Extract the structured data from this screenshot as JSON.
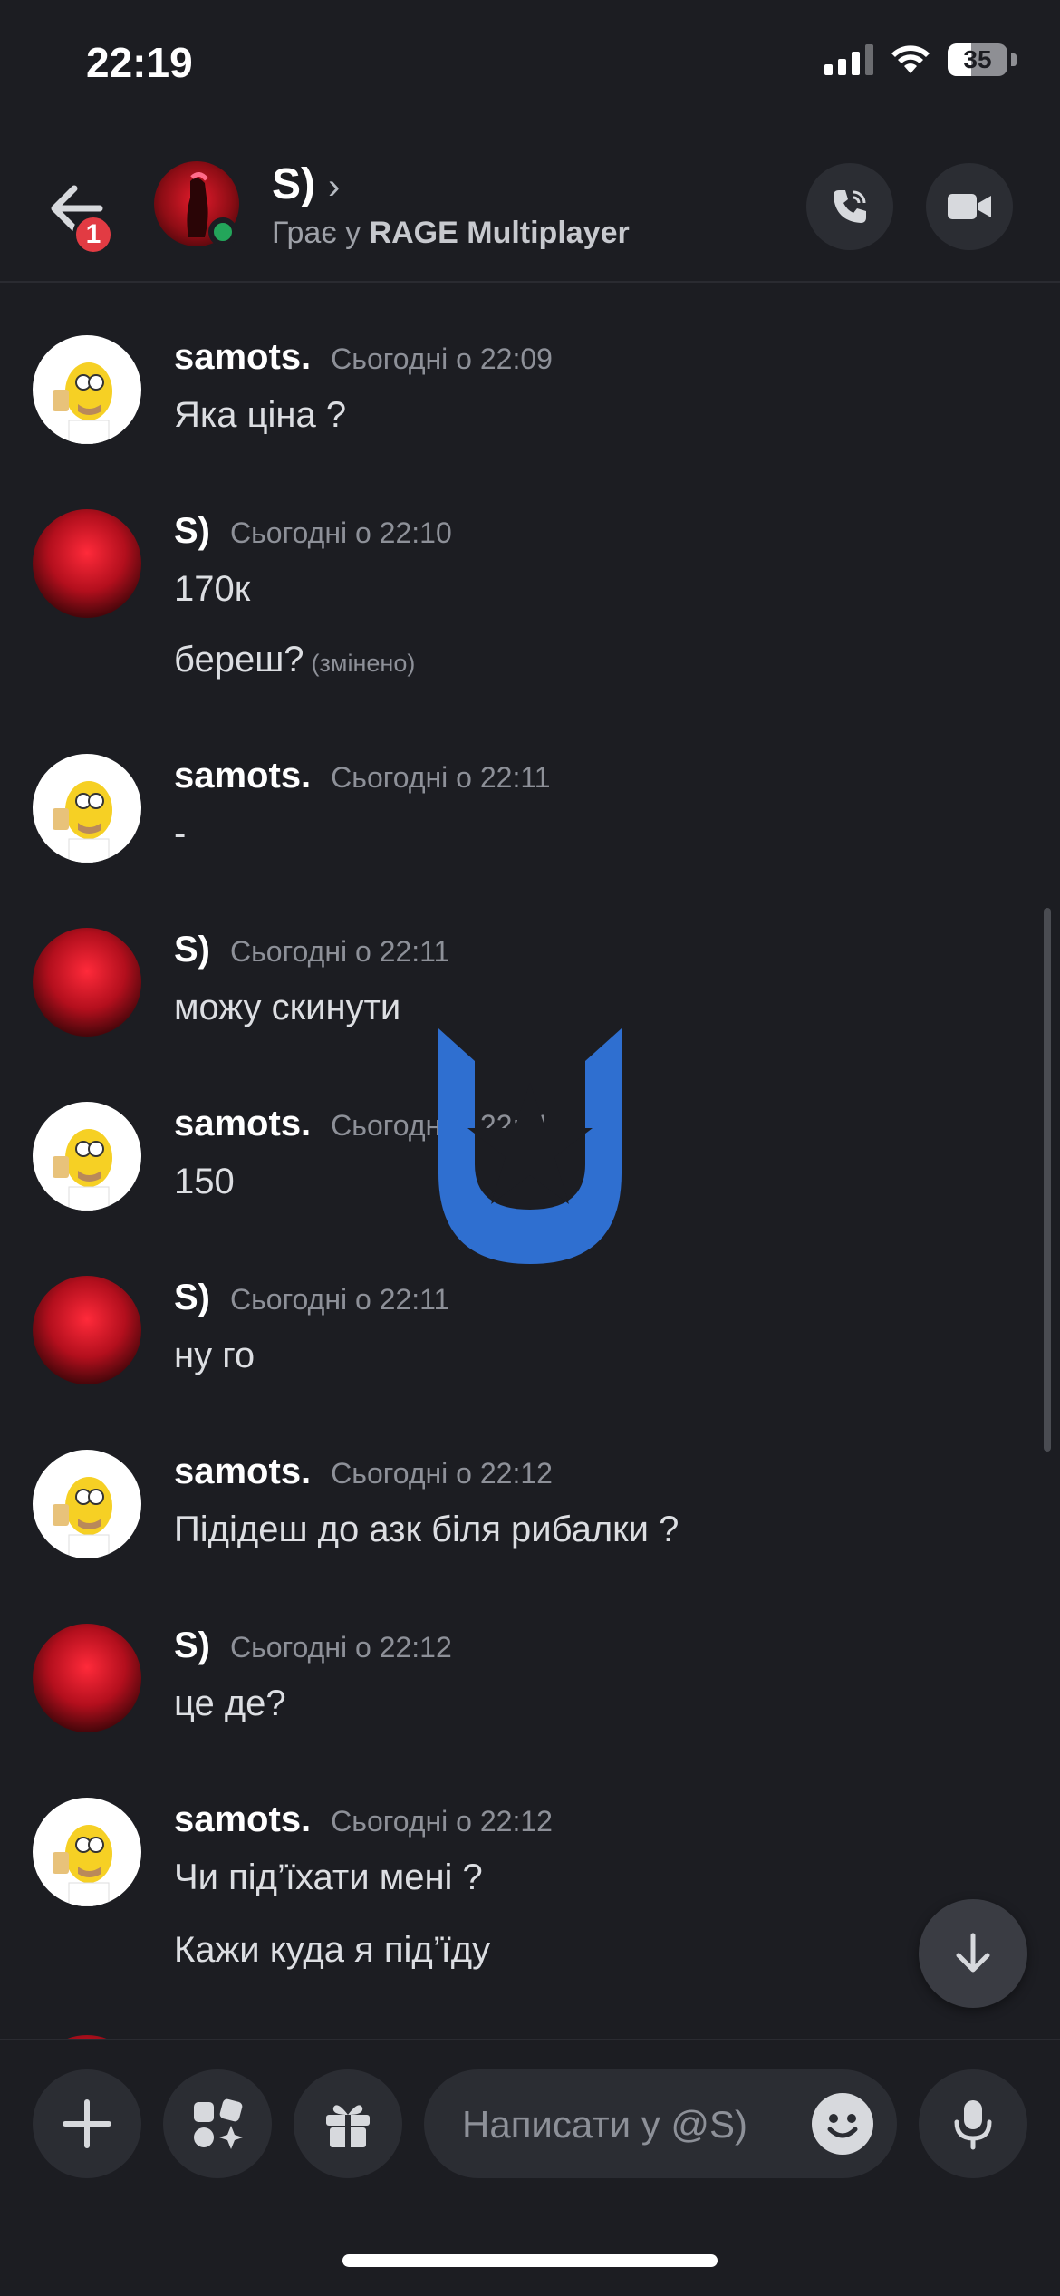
{
  "status_bar": {
    "time": "22:19",
    "battery": "35"
  },
  "header": {
    "name": "S)",
    "status_prefix": "Грає у ",
    "status_game": "RAGE Multiplayer",
    "unread_badge": "1",
    "icons": [
      "back-arrow-icon",
      "phone-call-icon",
      "video-camera-icon"
    ]
  },
  "messages": [
    {
      "author": "samots.",
      "time": "Сьогодні о 22:09",
      "lines": [
        "Яка ціна ?"
      ]
    },
    {
      "author": "S)",
      "time": "Сьогодні о 22:10",
      "lines": [
        "170к",
        "береш?"
      ],
      "edited": "(змінено)"
    },
    {
      "author": "samots.",
      "time": "Сьогодні о 22:11",
      "lines": [
        "-"
      ]
    },
    {
      "author": "S)",
      "time": "Сьогодні о 22:11",
      "lines": [
        "можу скинути"
      ]
    },
    {
      "author": "samots.",
      "time": "Сьогодні о 22:11",
      "lines": [
        "150"
      ]
    },
    {
      "author": "S)",
      "time": "Сьогодні о 22:11",
      "lines": [
        "ну го"
      ]
    },
    {
      "author": "samots.",
      "time": "Сьогодні о 22:12",
      "lines": [
        "Підідеш до азк біля рибалки ?"
      ]
    },
    {
      "author": "S)",
      "time": "Сьогодні о 22:12",
      "lines": [
        "це де?"
      ]
    },
    {
      "author": "samots.",
      "time": "Сьогодні о 22:12",
      "lines": [
        "Чи під’їхати мені ?",
        "Кажи куда  я під’їду"
      ]
    }
  ],
  "composer": {
    "placeholder": "Написати у @S)",
    "icons": [
      "plus-icon",
      "apps-icon",
      "gift-icon",
      "emoji-icon",
      "microphone-icon"
    ]
  },
  "colors": {
    "background": "#1c1d22",
    "online": "#23a55a",
    "badge": "#e23b43",
    "watermark": "#2f6fd0"
  }
}
